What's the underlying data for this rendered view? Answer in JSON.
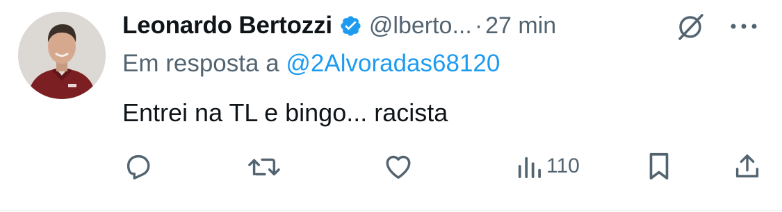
{
  "tweet": {
    "author": {
      "name": "Leonardo Bertozzi",
      "handle": "@lberto...",
      "verified": true
    },
    "separator": "·",
    "time": "27 min",
    "reply_prefix": "Em resposta a ",
    "reply_to": "@2Alvoradas68120",
    "text": "Entrei na TL e bingo... racista",
    "actions": {
      "views_count": "110"
    },
    "icons": [
      "verified-badge-icon",
      "grok-icon",
      "more-icon",
      "reply-icon",
      "retweet-icon",
      "like-icon",
      "views-icon",
      "bookmark-icon",
      "share-icon"
    ],
    "colors": {
      "accent": "#1d9bf0",
      "text": "#0f1419",
      "secondary": "#536471"
    }
  }
}
